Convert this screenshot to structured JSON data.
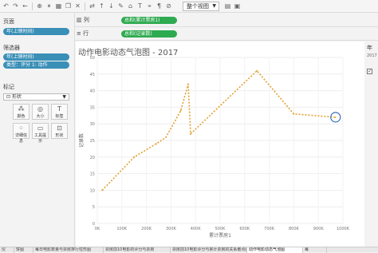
{
  "toolbar": {
    "view_select": "整个视图"
  },
  "left_panel": {
    "pages_title": "页面",
    "pages_pill": "年(上映时间)",
    "filters_title": "筛选器",
    "filters": [
      "年(上映时间)",
      "类型：评分 1: 动作"
    ],
    "marks_title": "标记",
    "marks_type": "形状",
    "mark_buttons": [
      "颜色",
      "大小",
      "标签",
      "详细信息",
      "工具提示",
      "形状"
    ]
  },
  "shelves": {
    "columns_label": "列",
    "columns_pill": "总和(累计票房1)",
    "rows_label": "行",
    "rows_pill": "总和(记录数)"
  },
  "chart_data": {
    "type": "line",
    "title": "动作电影动态气泡图 - 2017",
    "xlabel": "累计票房1",
    "ylabel": "记录数",
    "xlim": [
      0,
      1000000
    ],
    "ylim": [
      0,
      50
    ],
    "xticks": [
      "0K",
      "100K",
      "200K",
      "300K",
      "400K",
      "500K",
      "600K",
      "700K",
      "800K",
      "900K",
      "1000K"
    ],
    "yticks": [
      "0",
      "5",
      "10",
      "15",
      "20",
      "25",
      "30",
      "35",
      "40",
      "45",
      "50"
    ],
    "x": [
      20000,
      150000,
      240000,
      280000,
      340000,
      370000,
      380000,
      650000,
      800000,
      970000
    ],
    "y": [
      10,
      20,
      24,
      26,
      34,
      42,
      27,
      46,
      33,
      32
    ],
    "line_color": "#e1a030",
    "highlight_color": "#3b6fb6"
  },
  "right_panel": {
    "label": "年",
    "value": "2017"
  },
  "tabs": [
    "仪",
    "饼图",
    "每日电影数量与票房排行柱形图",
    "票房前10电影的评分与票房",
    "票房前10电影评分与累计票房的关系散点图",
    "动作电影动态气泡图",
    "每"
  ]
}
